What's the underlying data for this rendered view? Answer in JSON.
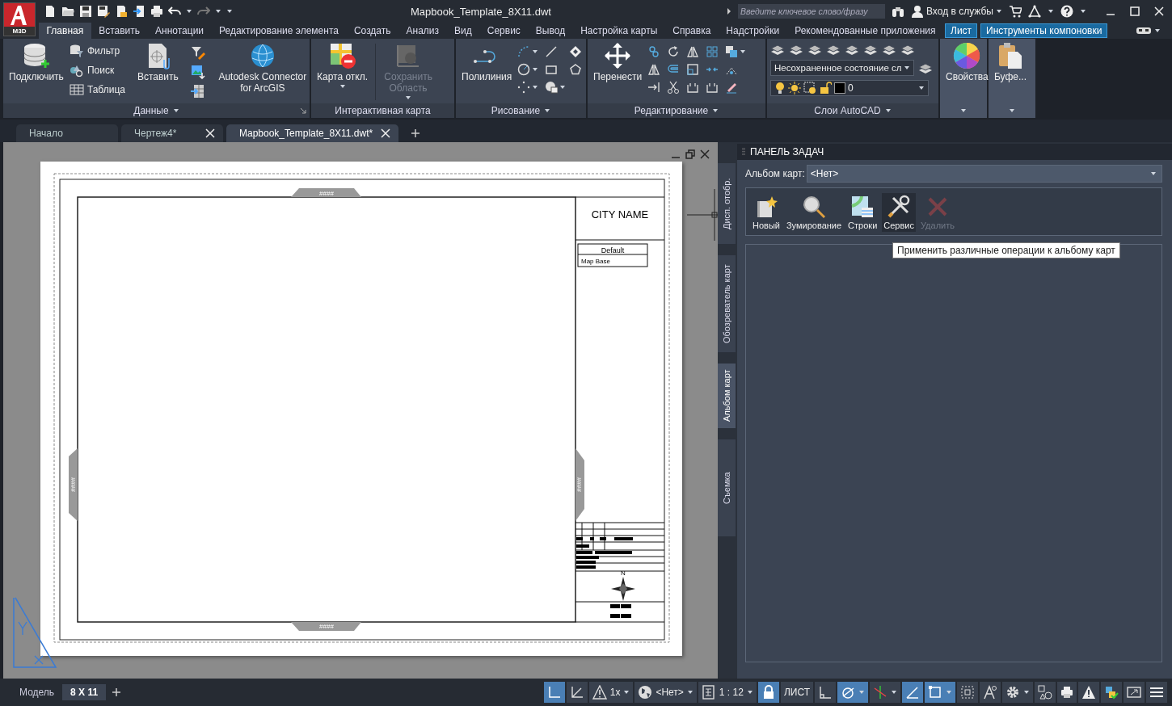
{
  "app": {
    "badge": "M3D"
  },
  "title_bar": {
    "title": "Mapbook_Template_8X11.dwt",
    "search_placeholder": "Введите ключевое слово/фразу",
    "sign_in": "Вход в службы"
  },
  "ribbon_tabs": [
    {
      "label": "Главная",
      "selected": true,
      "kind": "normal"
    },
    {
      "label": "Вставить",
      "selected": false,
      "kind": "normal"
    },
    {
      "label": "Аннотации",
      "selected": false,
      "kind": "normal"
    },
    {
      "label": "Редактирование элемента",
      "selected": false,
      "kind": "normal"
    },
    {
      "label": "Создать",
      "selected": false,
      "kind": "normal"
    },
    {
      "label": "Анализ",
      "selected": false,
      "kind": "normal"
    },
    {
      "label": "Вид",
      "selected": false,
      "kind": "normal"
    },
    {
      "label": "Сервис",
      "selected": false,
      "kind": "normal"
    },
    {
      "label": "Вывод",
      "selected": false,
      "kind": "normal"
    },
    {
      "label": "Настройка карты",
      "selected": false,
      "kind": "normal"
    },
    {
      "label": "Справка",
      "selected": false,
      "kind": "normal"
    },
    {
      "label": "Надстройки",
      "selected": false,
      "kind": "normal"
    },
    {
      "label": "Рекомендованные приложения",
      "selected": false,
      "kind": "normal"
    },
    {
      "label": "Лист",
      "selected": false,
      "kind": "contextual"
    },
    {
      "label": "Инструменты компоновки",
      "selected": false,
      "kind": "contextual"
    }
  ],
  "ribbon_panels": [
    {
      "title": "Данные",
      "buttons": [
        {
          "label": "Подключить",
          "kind": "large",
          "disabled": false
        },
        {
          "label": "Фильтр",
          "kind": "small",
          "disabled": false
        },
        {
          "label": "Поиск",
          "kind": "small",
          "disabled": false
        },
        {
          "label": "Таблица",
          "kind": "small",
          "disabled": false
        },
        {
          "label": "Вставить",
          "kind": "large",
          "disabled": false
        },
        {
          "label": "Autodesk Connector for ArcGIS",
          "kind": "large",
          "disabled": false
        }
      ]
    },
    {
      "title": "Интерактивная карта",
      "buttons": [
        {
          "label": "Карта откл.",
          "kind": "large",
          "disabled": false
        },
        {
          "label": "Сохранить Область",
          "kind": "large",
          "disabled": true
        }
      ]
    },
    {
      "title": "Рисование",
      "buttons": [
        {
          "label": "Полилиния",
          "kind": "large",
          "disabled": false
        }
      ]
    },
    {
      "title": "Редактирование",
      "buttons": [
        {
          "label": "Перенести",
          "kind": "large",
          "disabled": false
        }
      ]
    },
    {
      "title": "Слои AutoCAD",
      "layer_state": "Несохраненное состояние сл",
      "current_layer": "0"
    },
    {
      "buttons": [
        {
          "label": "Свойства",
          "kind": "large",
          "disabled": false
        }
      ]
    },
    {
      "buttons": [
        {
          "label": "Буфе...",
          "kind": "large",
          "disabled": false
        }
      ]
    }
  ],
  "doc_tabs": [
    {
      "label": "Начало",
      "selected": false,
      "closable": false
    },
    {
      "label": "Чертеж4*",
      "selected": false,
      "closable": true
    },
    {
      "label": "Mapbook_Template_8X11.dwt*",
      "selected": true,
      "closable": true
    }
  ],
  "drawing": {
    "city_name": "CITY NAME",
    "legend": [
      "Default",
      "Map Base"
    ],
    "markers": [
      "####",
      "####",
      "####",
      "####"
    ],
    "north": "N"
  },
  "task_pane": {
    "title": "ПАНЕЛЬ ЗАДАЧ",
    "side_tabs": [
      {
        "label": "Дисп. отобр.",
        "selected": false
      },
      {
        "label": "Обозреватель карт",
        "selected": false
      },
      {
        "label": "Альбом карт",
        "selected": true
      },
      {
        "label": "Съемка",
        "selected": false
      }
    ],
    "album_label": "Альбом карт:",
    "album_value": "<Нет>",
    "tools": [
      {
        "label": "Новый",
        "disabled": false,
        "selected": false
      },
      {
        "label": "Зумирование",
        "disabled": false,
        "selected": false
      },
      {
        "label": "Строки",
        "disabled": false,
        "selected": false
      },
      {
        "label": "Сервис",
        "disabled": false,
        "selected": true
      },
      {
        "label": "Удалить",
        "disabled": true,
        "selected": false
      }
    ],
    "tooltip": "Применить различные операции к альбому карт"
  },
  "layout_tabs": [
    {
      "label": "Модель",
      "selected": false
    },
    {
      "label": "8 X 11",
      "selected": true
    }
  ],
  "status_bar": [
    {
      "kind": "toggle",
      "on": true,
      "caret": false
    },
    {
      "kind": "toggle",
      "on": false,
      "caret": false
    },
    {
      "kind": "dropdown",
      "label": "1x",
      "caret": true
    },
    {
      "kind": "dropdown",
      "label": "<Нет>",
      "caret": true
    },
    {
      "kind": "dropdown",
      "label": "1 : 12",
      "caret": true
    },
    {
      "kind": "toggle",
      "on": true,
      "caret": false
    },
    {
      "kind": "text",
      "label": "ЛИСТ",
      "caret": false
    },
    {
      "kind": "toggle",
      "on": false,
      "caret": false
    },
    {
      "kind": "toggle",
      "on": true,
      "caret": true
    },
    {
      "kind": "toggle",
      "on": false,
      "caret": true
    },
    {
      "kind": "toggle",
      "on": true,
      "caret": false
    },
    {
      "kind": "toggle",
      "on": true,
      "caret": true
    },
    {
      "kind": "toggle",
      "on": false,
      "caret": false
    },
    {
      "kind": "toggle",
      "on": false,
      "caret": false
    },
    {
      "kind": "toggle",
      "on": false,
      "caret": true
    },
    {
      "kind": "toggle",
      "on": false,
      "caret": false
    },
    {
      "kind": "toggle",
      "on": false,
      "caret": false
    },
    {
      "kind": "toggle",
      "on": false,
      "caret": false
    },
    {
      "kind": "toggle",
      "on": false,
      "caret": false
    },
    {
      "kind": "toggle",
      "on": false,
      "caret": false
    },
    {
      "kind": "toggle",
      "on": false,
      "caret": false
    }
  ]
}
